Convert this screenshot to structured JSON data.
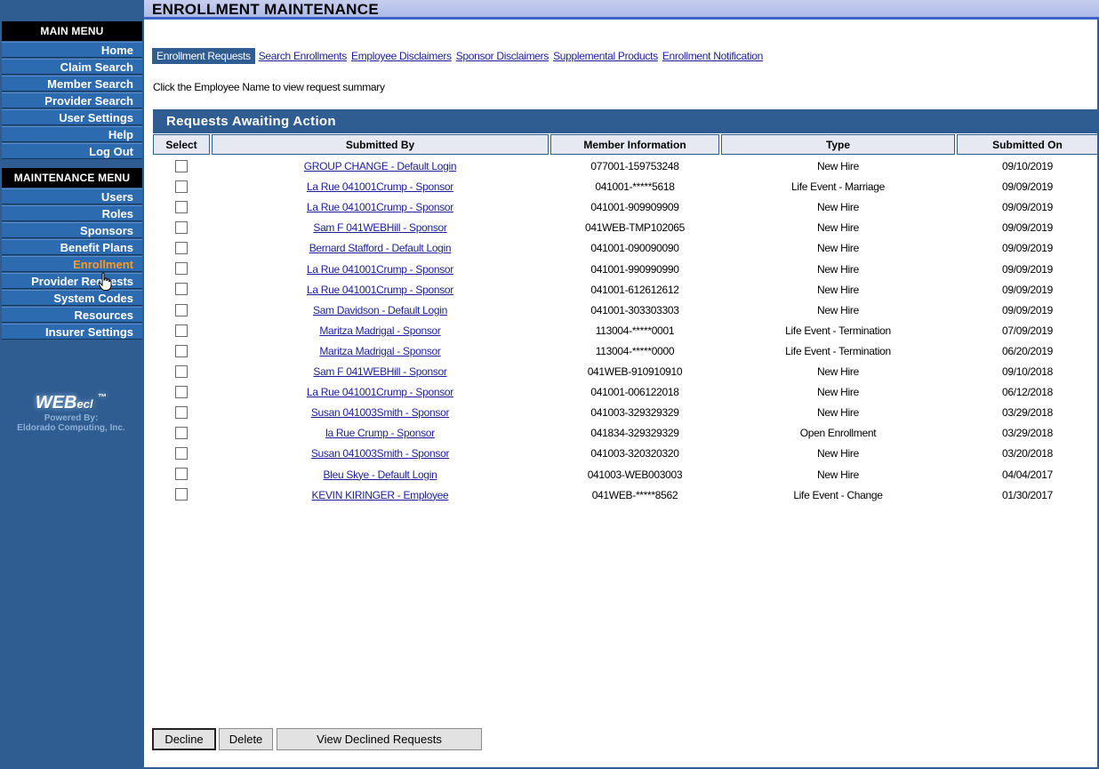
{
  "page_title": "ENROLLMENT MAINTENANCE",
  "main_menu": {
    "header": "MAIN MENU",
    "items": [
      "Home",
      "Claim Search",
      "Member Search",
      "Provider Search",
      "User Settings",
      "Help",
      "Log Out"
    ]
  },
  "maintenance_menu": {
    "header": "MAINTENANCE MENU",
    "items": [
      "Users",
      "Roles",
      "Sponsors",
      "Benefit Plans",
      "Enrollment",
      "Provider Requests",
      "System Codes",
      "Resources",
      "Insurer Settings"
    ],
    "active_item": "Enrollment"
  },
  "logo": {
    "mark": "WEB",
    "mark_suffix": "ecl",
    "trademark": "™",
    "powered_by": "Powered By:",
    "company": "Eldorado Computing, Inc."
  },
  "tabs": [
    "Enrollment Requests",
    "Search Enrollments",
    "Employee Disclaimers",
    "Sponsor Disclaimers",
    "Supplemental Products",
    "Enrollment Notification"
  ],
  "active_tab": "Enrollment Requests",
  "instruction": "Click the Employee Name to view request summary",
  "panel_title": "Requests Awaiting Action",
  "columns": [
    "Select",
    "Submitted By",
    "Member Information",
    "Type",
    "Submitted On"
  ],
  "rows": [
    {
      "submitted_by": "GROUP CHANGE - Default Login",
      "member_info": "077001-159753248",
      "type": "New Hire",
      "submitted_on": "09/10/2019"
    },
    {
      "submitted_by": "La Rue 041001Crump - Sponsor",
      "member_info": "041001-*****5618",
      "type": "Life Event - Marriage",
      "submitted_on": "09/09/2019"
    },
    {
      "submitted_by": "La Rue 041001Crump - Sponsor",
      "member_info": "041001-909909909",
      "type": "New Hire",
      "submitted_on": "09/09/2019"
    },
    {
      "submitted_by": "Sam F 041WEBHill - Sponsor",
      "member_info": "041WEB-TMP102065",
      "type": "New Hire",
      "submitted_on": "09/09/2019"
    },
    {
      "submitted_by": "Bernard Stafford - Default Login",
      "member_info": "041001-090090090",
      "type": "New Hire",
      "submitted_on": "09/09/2019"
    },
    {
      "submitted_by": "La Rue 041001Crump - Sponsor",
      "member_info": "041001-990990990",
      "type": "New Hire",
      "submitted_on": "09/09/2019"
    },
    {
      "submitted_by": "La Rue 041001Crump - Sponsor",
      "member_info": "041001-612612612",
      "type": "New Hire",
      "submitted_on": "09/09/2019"
    },
    {
      "submitted_by": "Sam Davidson - Default Login",
      "member_info": "041001-303303303",
      "type": "New Hire",
      "submitted_on": "09/09/2019"
    },
    {
      "submitted_by": "Maritza Madrigal - Sponsor",
      "member_info": "113004-*****0001",
      "type": "Life Event - Termination",
      "submitted_on": "07/09/2019"
    },
    {
      "submitted_by": "Maritza Madrigal - Sponsor",
      "member_info": "113004-*****0000",
      "type": "Life Event - Termination",
      "submitted_on": "06/20/2019"
    },
    {
      "submitted_by": "Sam F 041WEBHill - Sponsor",
      "member_info": "041WEB-910910910",
      "type": "New Hire",
      "submitted_on": "09/10/2018"
    },
    {
      "submitted_by": "La Rue 041001Crump - Sponsor",
      "member_info": "041001-006122018",
      "type": "New Hire",
      "submitted_on": "06/12/2018"
    },
    {
      "submitted_by": "Susan 041003Smith - Sponsor",
      "member_info": "041003-329329329",
      "type": "New Hire",
      "submitted_on": "03/29/2018"
    },
    {
      "submitted_by": "la Rue Crump - Sponsor",
      "member_info": "041834-329329329",
      "type": "Open Enrollment",
      "submitted_on": "03/29/2018"
    },
    {
      "submitted_by": "Susan 041003Smith - Sponsor",
      "member_info": "041003-320320320",
      "type": "New Hire",
      "submitted_on": "03/20/2018"
    },
    {
      "submitted_by": "Bleu Skye - Default Login",
      "member_info": "041003-WEB003003",
      "type": "New Hire",
      "submitted_on": "04/04/2017"
    },
    {
      "submitted_by": "KEVIN KIRINGER - Employee",
      "member_info": "041WEB-*****8562",
      "type": "Life Event - Change",
      "submitted_on": "01/30/2017"
    }
  ],
  "buttons": {
    "decline": "Decline",
    "delete": "Delete",
    "view_declined": "View Declined Requests"
  },
  "colors": {
    "sidebar": "#2f5d91",
    "menu_item": "#2d6bb0",
    "active_menu": "#ff9a1f",
    "link": "#1b1f9c",
    "panel_header": "#2f5d91"
  }
}
